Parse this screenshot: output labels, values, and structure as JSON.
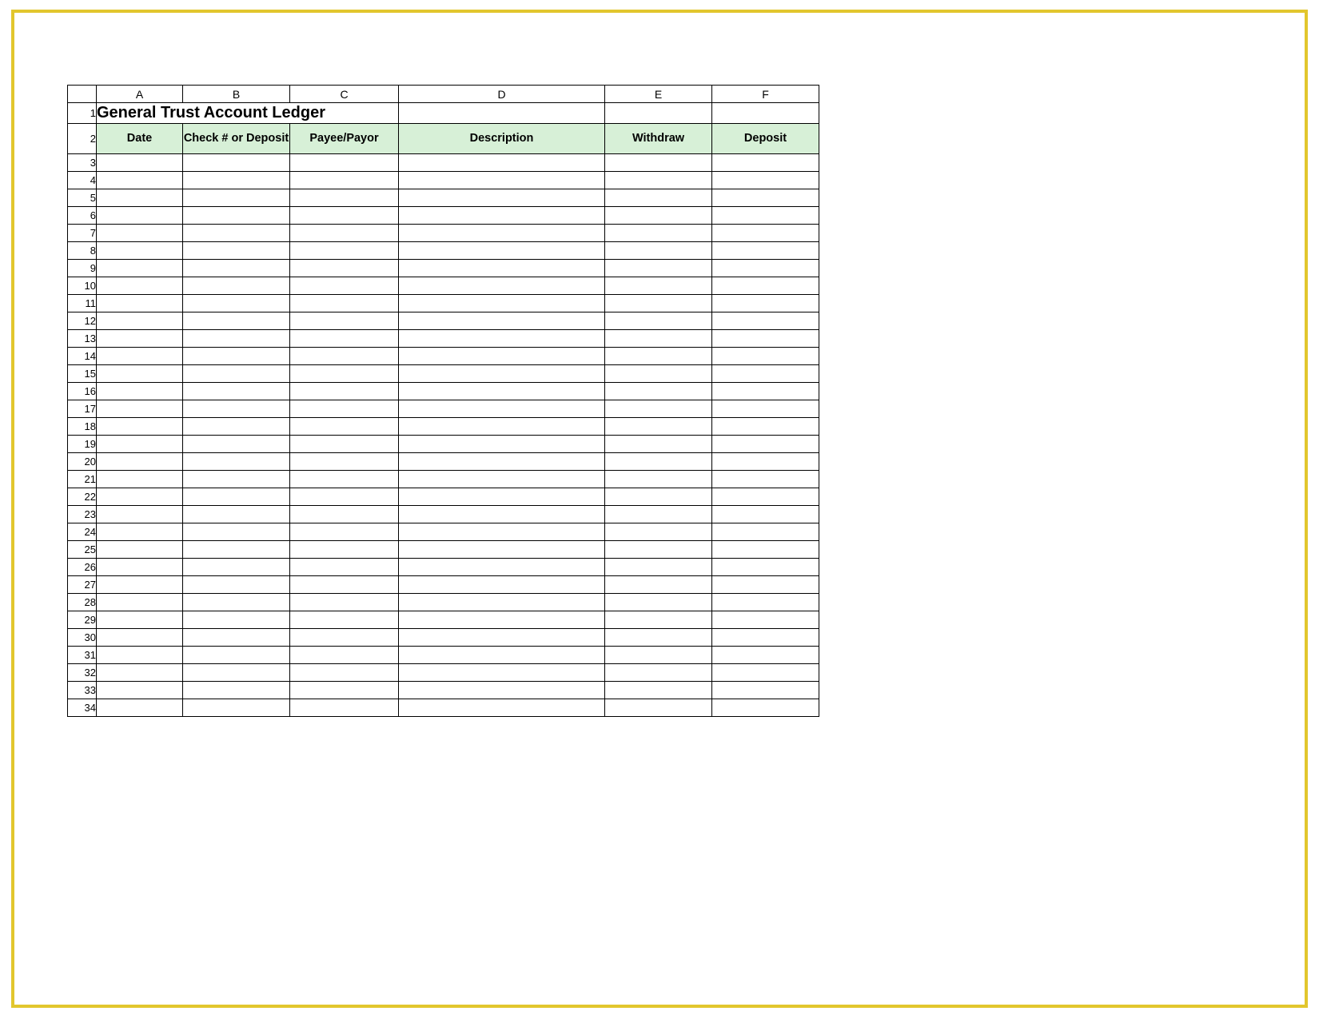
{
  "column_letters": [
    "A",
    "B",
    "C",
    "D",
    "E",
    "F"
  ],
  "row_numbers": [
    1,
    2,
    3,
    4,
    5,
    6,
    7,
    8,
    9,
    10,
    11,
    12,
    13,
    14,
    15,
    16,
    17,
    18,
    19,
    20,
    21,
    22,
    23,
    24,
    25,
    26,
    27,
    28,
    29,
    30,
    31,
    32,
    33,
    34
  ],
  "title": "General Trust Account Ledger",
  "headers": {
    "date": "Date",
    "check_or_deposit": "Check # or Deposit",
    "payee_payor": "Payee/Payor",
    "description": "Description",
    "withdraw": "Withdraw",
    "deposit": "Deposit"
  },
  "data_rows_count": 32,
  "colors": {
    "frame_border": "#e2c62d",
    "header_fill": "#d7f0d7"
  }
}
